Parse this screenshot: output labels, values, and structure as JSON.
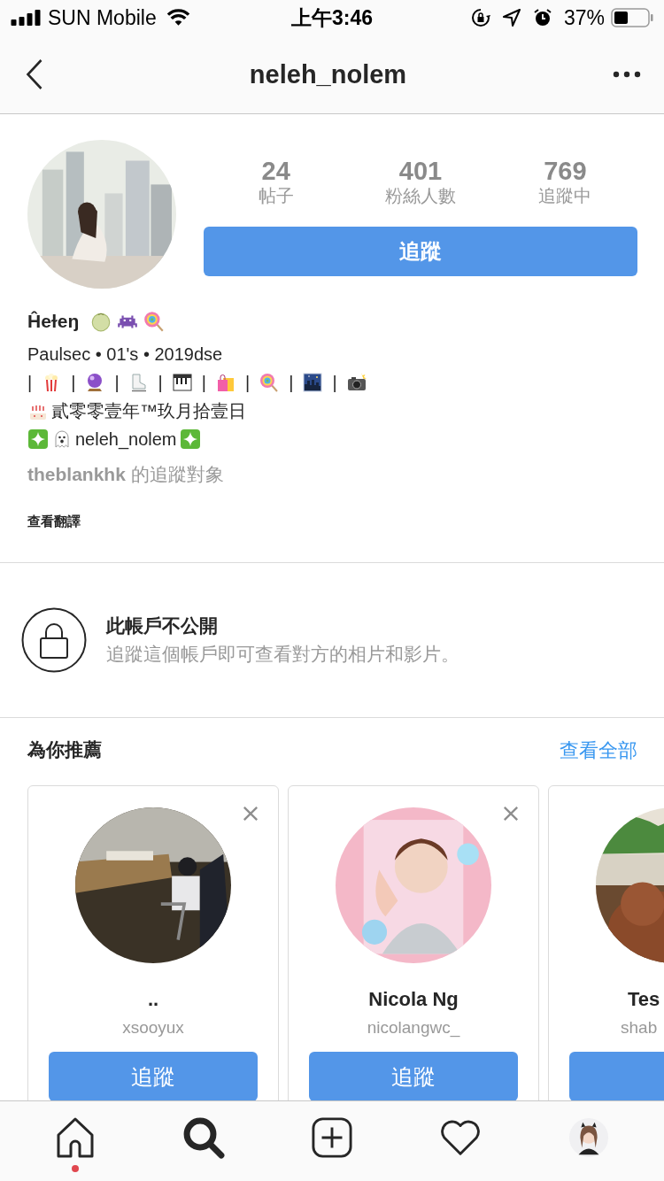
{
  "status_bar": {
    "carrier": "SUN Mobile",
    "time": "上午3:46",
    "battery": "37%"
  },
  "header": {
    "title": "neleh_nolem"
  },
  "profile": {
    "stats": [
      {
        "value": "24",
        "label": "帖子"
      },
      {
        "value": "401",
        "label": "粉絲人數"
      },
      {
        "value": "769",
        "label": "追蹤中"
      }
    ],
    "follow_button": "追蹤",
    "name": "Ĥeɫeŋ",
    "bio_line": "Paulsec • 01's • 2019dse",
    "icon_separators": [
      "|",
      "|",
      "|",
      "|",
      "|",
      "|",
      "|",
      "|"
    ],
    "birthday": "貳零零壹年™玖月拾壹日",
    "handle": "neleh_nolem",
    "followed_by": "**theblankhk** 的追蹤對象",
    "translate_link": "查看翻譯"
  },
  "private_notice": {
    "title": "此帳戶不公開",
    "text": "追蹤這個帳戶即可查看對方的相片和影片。"
  },
  "suggestions": {
    "title": "為你推薦",
    "see_all": "查看全部",
    "cards": [
      {
        "name": "..",
        "username": "xsooyux",
        "button": "追蹤",
        "dismissible": true,
        "cut_off": false
      },
      {
        "name": "Nicola Ng",
        "username": "nicolangwc_",
        "button": "追蹤",
        "dismissible": true,
        "cut_off": false
      },
      {
        "name": "Tes",
        "username": "shab",
        "dismissible": false,
        "cut_off": true
      }
    ]
  },
  "tab_bar": {
    "items": [
      {
        "kind": "home",
        "selected": false,
        "badge": true
      },
      {
        "kind": "search",
        "selected": true,
        "badge": false
      },
      {
        "kind": "add",
        "selected": false,
        "badge": false
      },
      {
        "kind": "activity",
        "selected": false,
        "badge": false
      },
      {
        "kind": "profile",
        "selected": false,
        "badge": false
      }
    ]
  }
}
